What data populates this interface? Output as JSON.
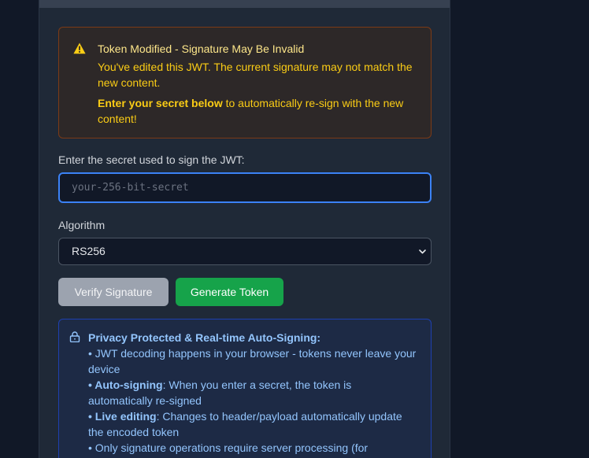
{
  "warning": {
    "icon": "warning-triangle-icon",
    "title": "Token Modified - Signature May Be Invalid",
    "text": "You've edited this JWT. The current signature may not match the new content.",
    "cta_bold": "Enter your secret below",
    "cta_rest": " to automatically re-sign with the new content!"
  },
  "secret": {
    "label": "Enter the secret used to sign the JWT:",
    "value": "",
    "placeholder": "your-256-bit-secret"
  },
  "algorithm": {
    "label": "Algorithm",
    "selected": "RS256",
    "icon": "chevron-down-icon"
  },
  "actions": {
    "verify_label": "Verify Signature",
    "generate_label": "Generate Token"
  },
  "privacy": {
    "icon": "lock-icon",
    "title": "Privacy Protected & Real-time Auto-Signing:",
    "items": [
      {
        "bold": "",
        "text": "• JWT decoding happens in your browser - tokens never leave your device"
      },
      {
        "bold": "• Auto-signing",
        "text": ": When you enter a secret, the token is automatically re-signed"
      },
      {
        "bold": "• Live editing",
        "text": ": Changes to header/payload automatically update the encoded token"
      },
      {
        "bold": "",
        "text": "• Only signature operations require server processing (for"
      }
    ]
  },
  "colors": {
    "page_bg": "#111827",
    "panel_bg": "#1f2937",
    "warning_text": "#facc15",
    "accent_blue": "#3b82f6",
    "generate_green": "#16a34a",
    "verify_gray": "#9ca3af",
    "privacy_text": "#93c5fd"
  }
}
